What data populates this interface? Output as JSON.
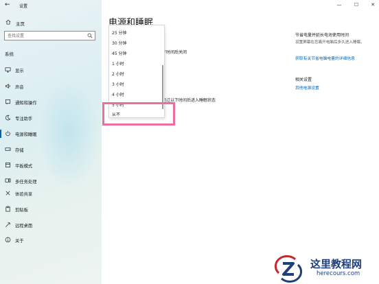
{
  "window": {
    "title": "设置",
    "minimize": "—",
    "maximize": "☐",
    "close": "✕"
  },
  "sidebar": {
    "home_label": "主页",
    "search_placeholder": "查找设置",
    "section_label": "系统",
    "items": [
      {
        "label": "显示",
        "icon": "monitor-icon"
      },
      {
        "label": "声音",
        "icon": "speaker-icon"
      },
      {
        "label": "通知和操作",
        "icon": "notification-icon"
      },
      {
        "label": "专注助手",
        "icon": "moon-icon"
      },
      {
        "label": "电源和睡眠",
        "icon": "power-icon",
        "active": true
      },
      {
        "label": "存储",
        "icon": "storage-icon"
      },
      {
        "label": "平板模式",
        "icon": "tablet-icon"
      },
      {
        "label": "多任务处理",
        "icon": "multitask-icon"
      },
      {
        "label": "体验共享",
        "icon": "share-experience-icon"
      },
      {
        "label": "剪贴板",
        "icon": "clipboard-icon"
      },
      {
        "label": "远程桌面",
        "icon": "remote-desktop-icon"
      },
      {
        "label": "关于",
        "icon": "info-icon"
      }
    ]
  },
  "main": {
    "title": "电源和睡眠",
    "screen_label_partial": "下时间后关闭",
    "sleep_label_partial": "经过以下时间后进入睡眠状态"
  },
  "dropdown": {
    "options": [
      "25 分钟",
      "30 分钟",
      "45 分钟",
      "1 小时",
      "2 小时",
      "3 小时",
      "4 小时",
      "5 小时",
      "从不"
    ],
    "selected": "从不"
  },
  "right_panel": {
    "title": "节省电量并延长电池使用时间",
    "description": "设置屏幕在您离开电脑后多久进入睡眠。",
    "link": "获取有关节省电脑电量的详细信息",
    "related_title": "相关设置",
    "related_link": "其他电源设置"
  },
  "watermark": {
    "name": "这里教程网",
    "url": "herecours.com"
  },
  "colors": {
    "accent": "#0063b1",
    "link": "#0067b8",
    "highlight": "#ec6ea1",
    "watermark": "#1f3f7a"
  }
}
